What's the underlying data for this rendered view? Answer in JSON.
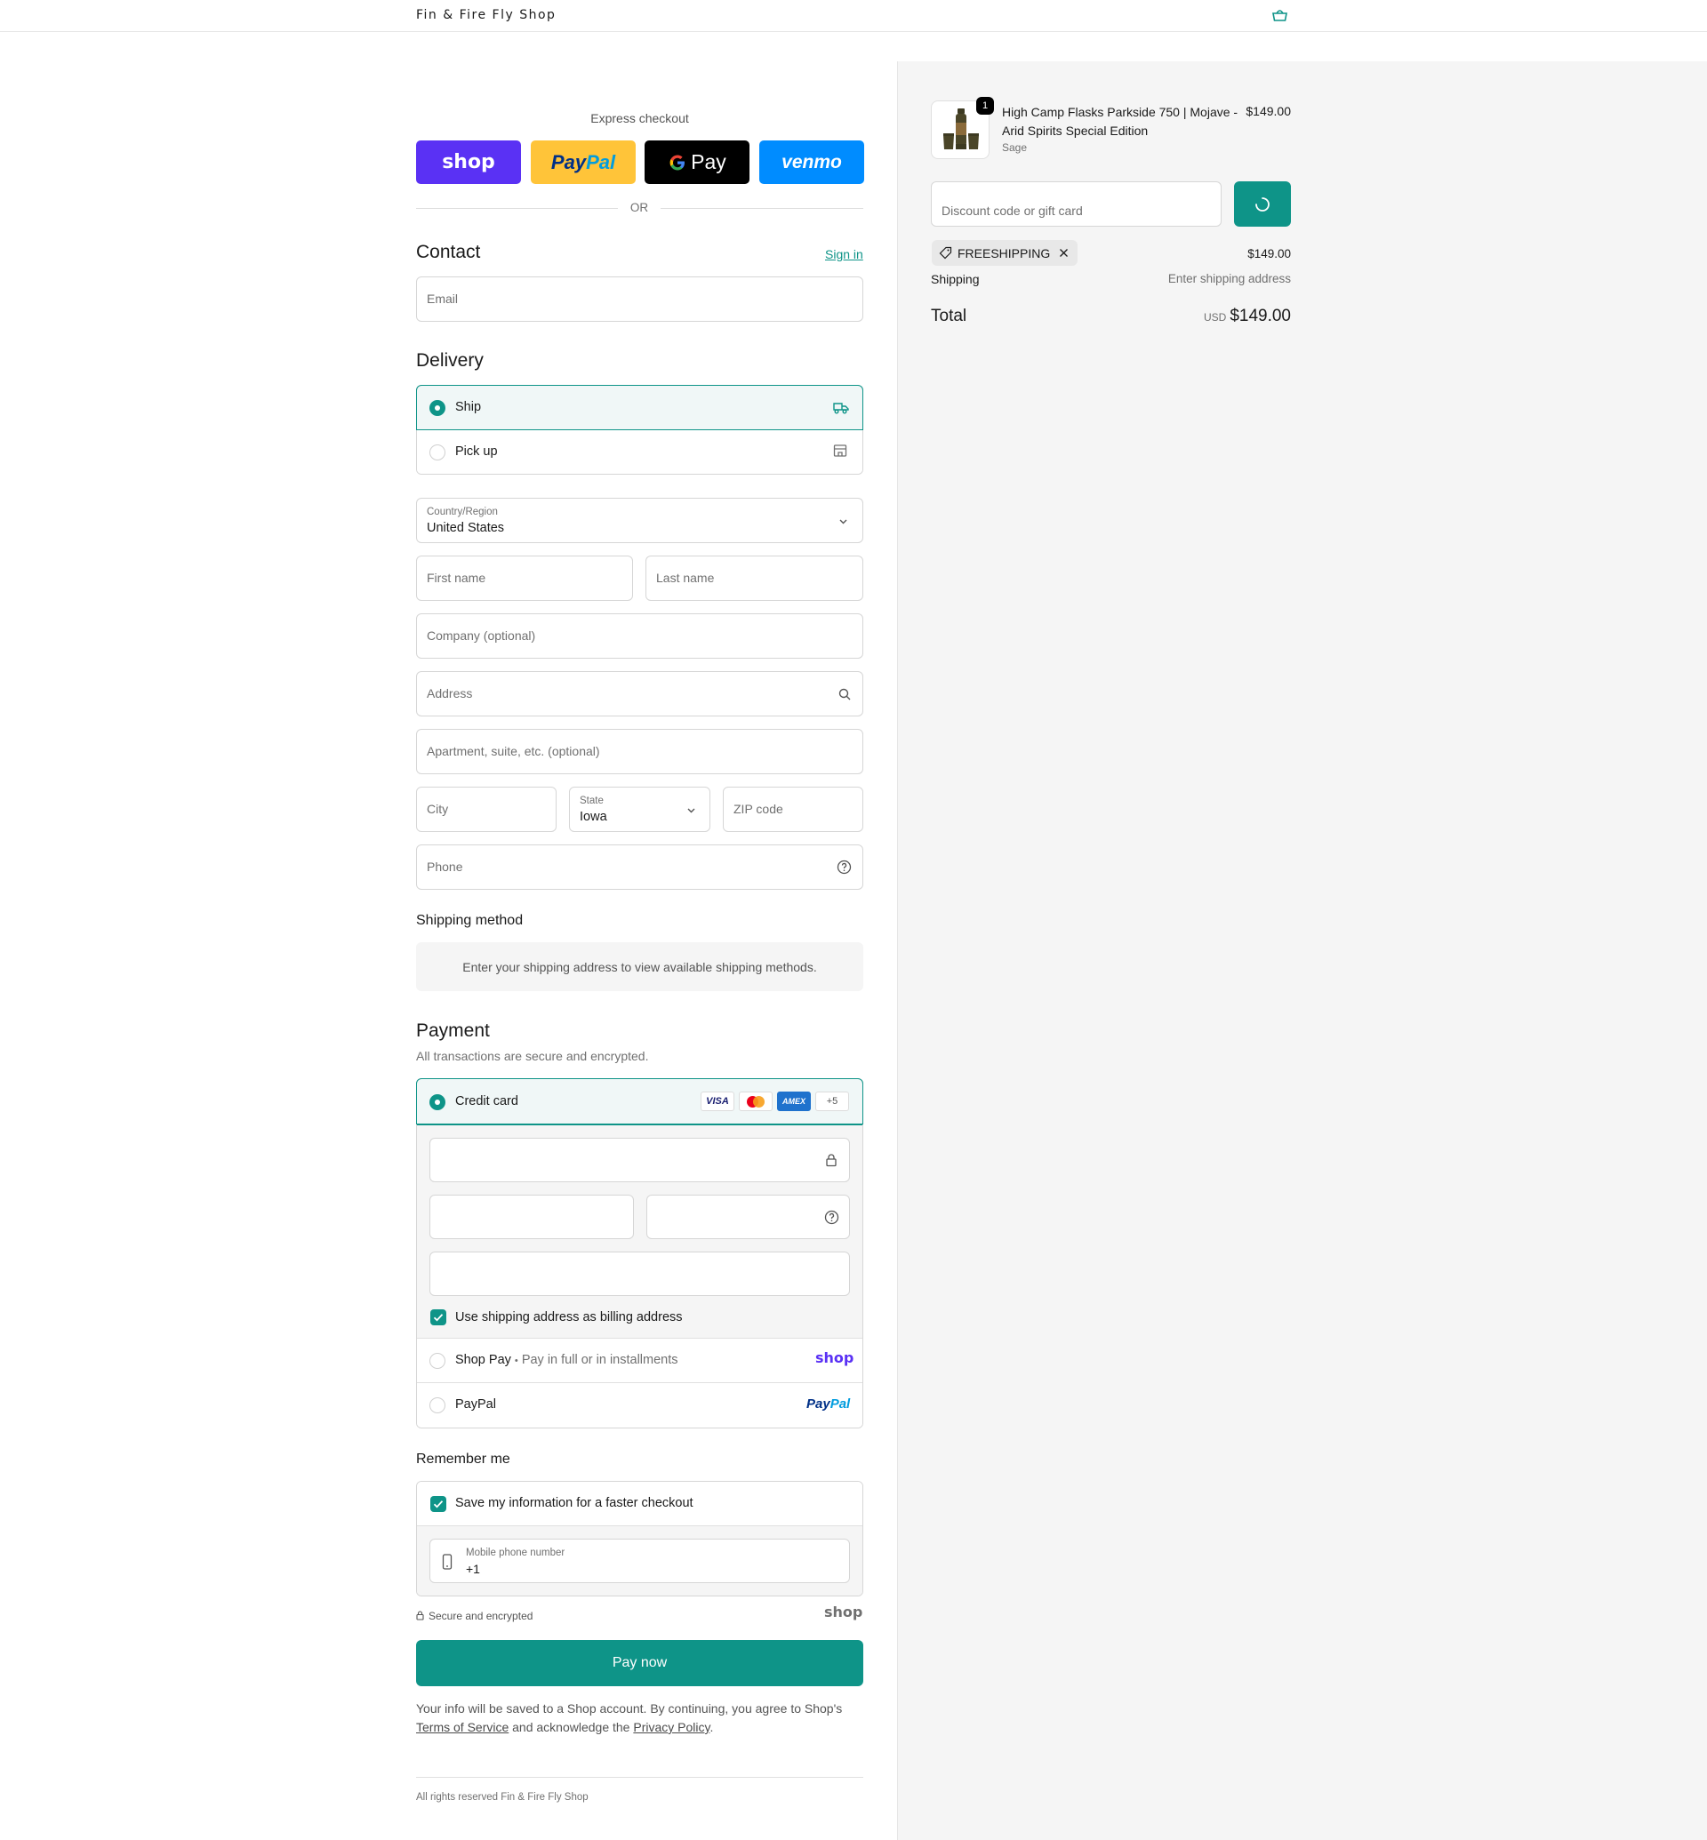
{
  "header": {
    "brand": "Fin & Fire Fly Shop",
    "cart_icon": "bag-icon"
  },
  "express": {
    "title": "Express checkout",
    "shop_pay": "shop",
    "paypal_pay": "Pay",
    "paypal_pal": "Pal",
    "gpay": "Pay",
    "venmo": "venmo",
    "or": "OR",
    "colors": {
      "shop": "#5a31f4",
      "paypal": "#ffc439",
      "gpay": "#000000",
      "venmo": "#008cff"
    }
  },
  "contact": {
    "title": "Contact",
    "sign_in": "Sign in",
    "email_placeholder": "Email"
  },
  "delivery": {
    "title": "Delivery",
    "options": [
      {
        "label": "Ship",
        "selected": true,
        "icon": "truck-icon"
      },
      {
        "label": "Pick up",
        "selected": false,
        "icon": "store-icon"
      }
    ],
    "country_label": "Country/Region",
    "country_value": "United States",
    "first_name": "First name",
    "last_name": "Last name",
    "company": "Company (optional)",
    "address": "Address",
    "apartment": "Apartment, suite, etc. (optional)",
    "city": "City",
    "state_label": "State",
    "state_value": "Iowa",
    "zip": "ZIP code",
    "phone": "Phone"
  },
  "shipping_method": {
    "title": "Shipping method",
    "message": "Enter your shipping address to view available shipping methods."
  },
  "payment": {
    "title": "Payment",
    "subtitle": "All transactions are secure and encrypted.",
    "credit_card_label": "Credit card",
    "card_logos": [
      "VISA",
      "mastercard",
      "AMEX",
      "+5"
    ],
    "billing_checkbox": "Use shipping address as billing address",
    "shop_pay_label": "Shop Pay",
    "shop_pay_separator": "•",
    "shop_pay_desc": "Pay in full or in installments",
    "shop_pay_logo": "shop",
    "paypal_label": "PayPal",
    "paypal_logo_pay": "Pay",
    "paypal_logo_pal": "Pal"
  },
  "remember": {
    "title": "Remember me",
    "save_label": "Save my information for a faster checkout",
    "mobile_label": "Mobile phone number",
    "mobile_value": "+1"
  },
  "secure": {
    "label": "Secure and encrypted",
    "shop_logo": "shop"
  },
  "pay_now": "Pay now",
  "legal": {
    "prefix": "Your info will be saved to a Shop account. By continuing, you agree to Shop's",
    "terms": "Terms of Service",
    "middle": "and acknowledge the",
    "privacy": "Privacy Policy",
    "suffix": "."
  },
  "footer": "All rights reserved Fin & Fire Fly Shop",
  "summary": {
    "item": {
      "quantity": "1",
      "name": "High Camp Flasks Parkside 750 | Mojave - Arid Spirits Special Edition",
      "variant": "Sage",
      "price": "$149.00"
    },
    "discount_placeholder": "Discount code or gift card",
    "discount_tag": "FREESHIPPING",
    "subtotal_value": "$149.00",
    "shipping_label": "Shipping",
    "shipping_value": "Enter shipping address",
    "total_label": "Total",
    "currency": "USD",
    "total_value": "$149.00"
  },
  "accent_color": "#0e9488"
}
